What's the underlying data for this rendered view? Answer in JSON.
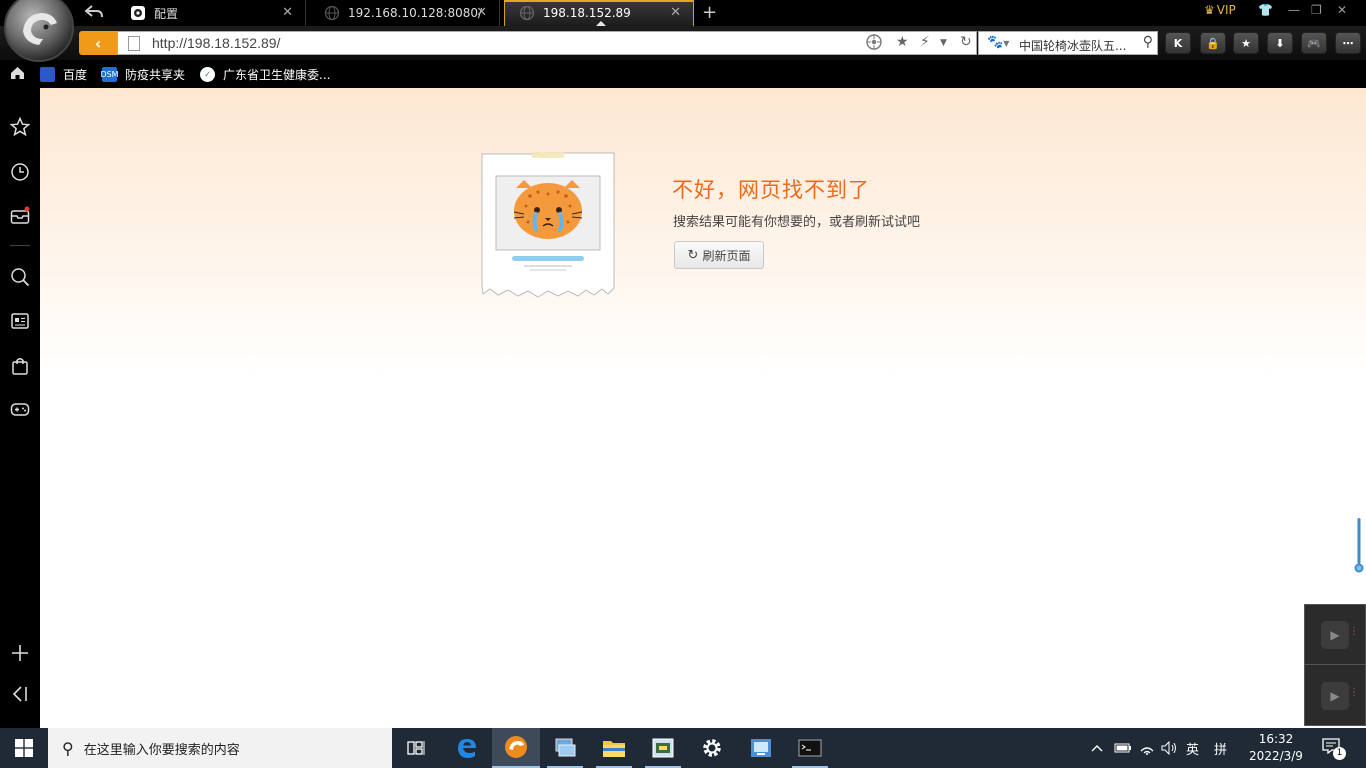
{
  "browser": {
    "tabs": [
      {
        "label": "配置",
        "icon": "camera-icon"
      },
      {
        "label": "192.168.10.128:8080/",
        "icon": "globe-icon"
      },
      {
        "label": "198.18.152.89",
        "icon": "globe-icon",
        "active": true
      }
    ],
    "vip_label": "VIP",
    "address": "http://198.18.152.89/",
    "search": {
      "engine": "baidu-icon",
      "text": "中国轮椅冰壶队五..."
    },
    "toolbar_buttons": [
      "k-icon",
      "lock-icon",
      "star-icon",
      "download-icon",
      "gamepad-icon",
      "more-icon"
    ],
    "toolbar_k_label": "K",
    "accent_color": "#f19a17"
  },
  "bookmarks": [
    {
      "label": "百度",
      "icon": "baidu-icon"
    },
    {
      "label": "防疫共享夹",
      "icon": "dsm-icon",
      "icon_text": "DSM"
    },
    {
      "label": "广东省卫生健康委...",
      "icon": "gov-icon"
    }
  ],
  "sidebar": {
    "items": [
      "favorites-star-icon",
      "history-clock-icon",
      "mailbox-icon",
      "search-icon",
      "news-icon",
      "shopping-bag-icon",
      "gamepad-icon"
    ],
    "bottom": [
      "add-icon",
      "collapse-icon"
    ]
  },
  "error_page": {
    "title": "不好，网页找不到了",
    "subtitle": "搜索结果可能有你想要的，或者刷新试试吧",
    "refresh_label": "刷新页面",
    "title_color": "#ef6a1b"
  },
  "taskbar": {
    "search_placeholder": "在这里输入你要搜索的内容",
    "apps": [
      "task-view-icon",
      "edge-icon",
      "browser-icon",
      "remote-desktop-icon",
      "file-explorer-icon",
      "control-panel-icon",
      "settings-icon",
      "network-app-icon",
      "terminal-icon"
    ],
    "ime_label": "英",
    "ime_mode": "拼",
    "time": "16:32",
    "date": "2022/3/9",
    "notification_count": "1"
  }
}
